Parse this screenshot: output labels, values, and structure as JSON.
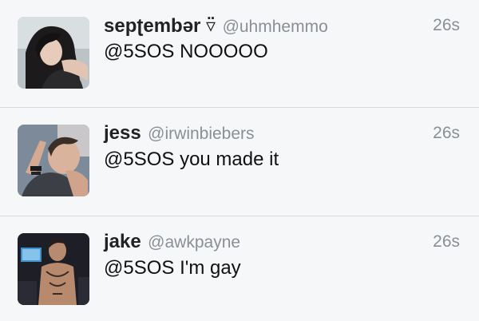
{
  "tweets": [
    {
      "display_name": "sepʈembər ▿̈",
      "handle": "@uhmhemmo",
      "time": "26s",
      "text": "@5SOS NOOOOO"
    },
    {
      "display_name": "jess",
      "handle": "@irwinbiebers",
      "time": "26s",
      "text": "@5SOS you made it"
    },
    {
      "display_name": "jake",
      "handle": "@awkpayne",
      "time": "26s",
      "text": "@5SOS I'm gay"
    }
  ]
}
